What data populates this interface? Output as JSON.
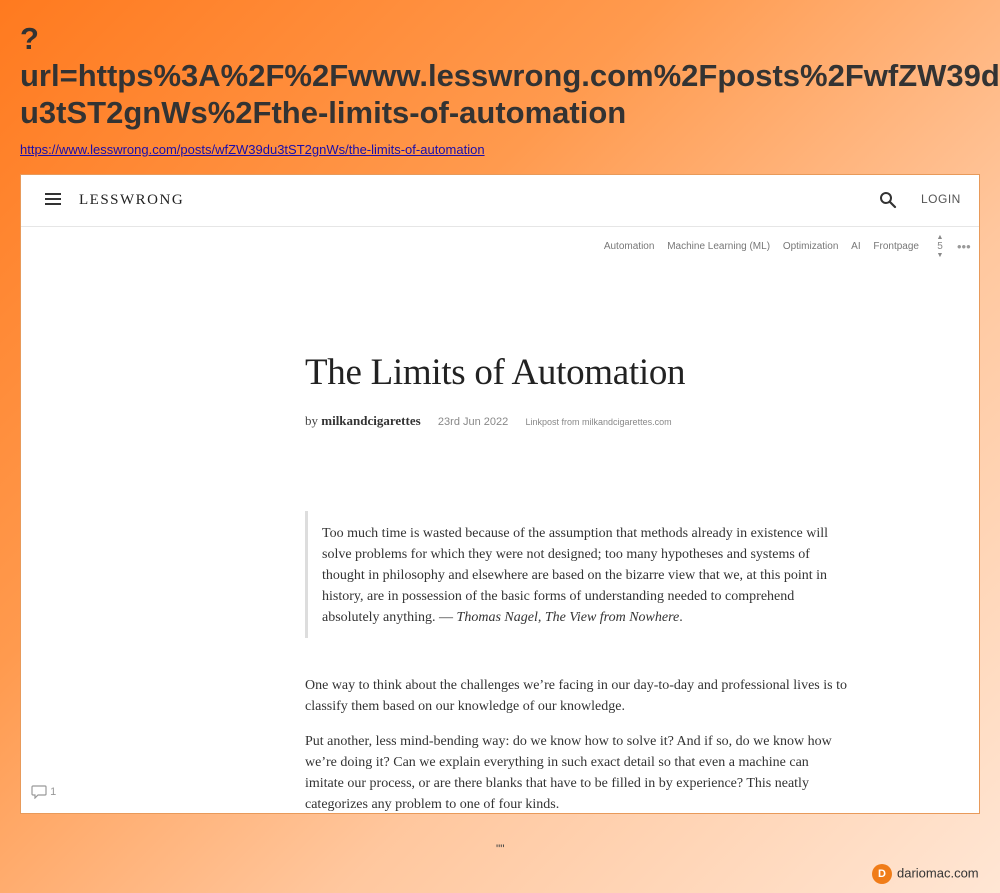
{
  "page": {
    "title": "?\nurl=https%3A%2F%2Fwww.lesswrong.com%2Fposts%2FwfZW39du3tST2gnWs%2Fthe-limits-of-automation",
    "link": "https://www.lesswrong.com/posts/wfZW39du3tST2gnWs/the-limits-of-automation"
  },
  "header": {
    "logo": "LESSWRONG",
    "login": "LOGIN",
    "menu_icon": "hamburger-menu-icon",
    "search_icon": "search-icon"
  },
  "tags": [
    "Automation",
    "Machine Learning (ML)",
    "Optimization",
    "AI",
    "Frontpage"
  ],
  "vote": {
    "score": "5"
  },
  "more_icon": "ellipsis-icon",
  "post": {
    "title": "The Limits of Automation",
    "by": "by",
    "author": "milkandcigarettes",
    "date": "23rd Jun 2022",
    "linkpost": "Linkpost from milkandcigarettes.com",
    "quote_text": "Too much time is wasted because of the assumption that methods already in existence will solve problems for which they were not designed; too many hypotheses and systems of thought in philosophy and elsewhere are based on the bizarre view that we, at this point in history, are in possession of the basic forms of understanding needed to comprehend absolutely anything. — ",
    "quote_attribution": "Thomas Nagel, The View from Nowhere",
    "quote_end": ".",
    "paragraphs": [
      "One way to think about the challenges we’re facing in our day-to-day and professional lives is to classify them based on our knowledge of our knowledge.",
      "Put another, less mind-bending way: do we know how to solve it? And if so, do we know how we’re doing it? Can we explain everything in such exact detail so that even a machine can imitate our process, or are there blanks that have to be filled in by experience? This neatly categorizes any problem to one of four kinds."
    ]
  },
  "comments": {
    "count": "1",
    "icon": "comment-icon"
  },
  "footer": {
    "quote_marks": "\"\"",
    "credit": "dariomac.com",
    "badge_letter": "D"
  }
}
